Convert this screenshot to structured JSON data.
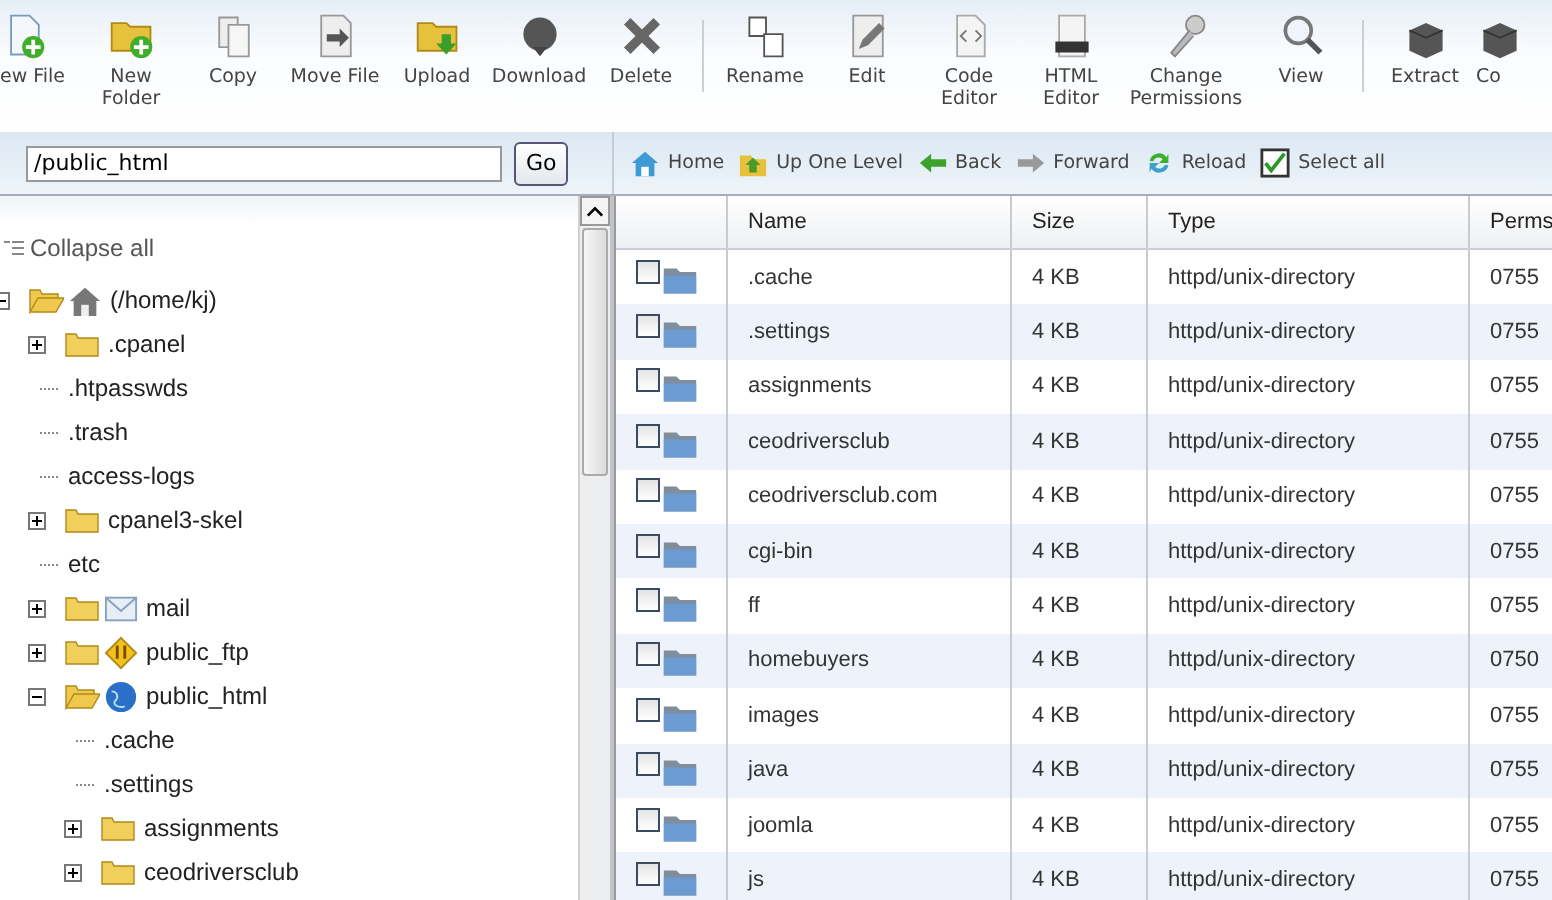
{
  "toolbar": [
    {
      "items": [
        {
          "kind": "new-file",
          "label": "ew File"
        },
        {
          "kind": "new-folder",
          "label": "New Folder"
        },
        {
          "kind": "copy",
          "label": "Copy"
        },
        {
          "kind": "move",
          "label": "Move File"
        },
        {
          "kind": "upload",
          "label": "Upload"
        },
        {
          "kind": "download",
          "label": "Download"
        },
        {
          "kind": "delete",
          "label": "Delete"
        }
      ]
    },
    {
      "items": [
        {
          "kind": "rename",
          "label": "Rename"
        },
        {
          "kind": "edit",
          "label": "Edit"
        },
        {
          "kind": "code",
          "label": "Code Editor"
        },
        {
          "kind": "html",
          "label": "HTML Editor"
        },
        {
          "kind": "permissions",
          "label": "Change Permissions"
        },
        {
          "kind": "view",
          "label": "View"
        }
      ]
    },
    {
      "items": [
        {
          "kind": "extract",
          "label": "Extract"
        },
        {
          "kind": "compress",
          "label": "Co"
        }
      ]
    }
  ],
  "path_field": {
    "value": "/public_html",
    "button": "Go"
  },
  "nav": [
    {
      "kind": "home",
      "label": "Home"
    },
    {
      "kind": "up",
      "label": "Up One Level"
    },
    {
      "kind": "back",
      "label": "Back"
    },
    {
      "kind": "forward",
      "label": "Forward"
    },
    {
      "kind": "reload",
      "label": "Reload"
    },
    {
      "kind": "select-all",
      "label": "Select all"
    }
  ],
  "tree": {
    "collapse_label": "Collapse all",
    "items": [
      {
        "kind": "home",
        "label": "(/home/kj)",
        "expanded": true,
        "children": [
          {
            "kind": "folder",
            "label": ".cpanel",
            "expanded": false
          },
          {
            "kind": "file",
            "label": ".htpasswds"
          },
          {
            "kind": "file",
            "label": ".trash"
          },
          {
            "kind": "file",
            "label": "access-logs"
          },
          {
            "kind": "folder",
            "label": "cpanel3-skel",
            "expanded": false
          },
          {
            "kind": "file",
            "label": "etc"
          },
          {
            "kind": "mail",
            "label": "mail",
            "expanded": false
          },
          {
            "kind": "ftp",
            "label": "public_ftp",
            "expanded": false
          },
          {
            "kind": "web",
            "label": "public_html",
            "expanded": true,
            "children": [
              {
                "kind": "file",
                "label": ".cache"
              },
              {
                "kind": "file",
                "label": ".settings"
              },
              {
                "kind": "folder",
                "label": "assignments",
                "expanded": false
              },
              {
                "kind": "folder",
                "label": "ceodriversclub",
                "expanded": false
              }
            ]
          }
        ]
      }
    ]
  },
  "table": {
    "columns": [
      "Name",
      "Size",
      "Type",
      "Perms"
    ],
    "rows": [
      {
        "checked": false,
        "name": ".cache",
        "size": "4 KB",
        "type": "httpd/unix-directory",
        "perms": "0755"
      },
      {
        "checked": false,
        "name": ".settings",
        "size": "4 KB",
        "type": "httpd/unix-directory",
        "perms": "0755"
      },
      {
        "checked": false,
        "name": "assignments",
        "size": "4 KB",
        "type": "httpd/unix-directory",
        "perms": "0755"
      },
      {
        "checked": false,
        "name": "ceodriversclub",
        "size": "4 KB",
        "type": "httpd/unix-directory",
        "perms": "0755"
      },
      {
        "checked": false,
        "name": "ceodriversclub.com",
        "size": "4 KB",
        "type": "httpd/unix-directory",
        "perms": "0755"
      },
      {
        "checked": false,
        "name": "cgi-bin",
        "size": "4 KB",
        "type": "httpd/unix-directory",
        "perms": "0755"
      },
      {
        "checked": false,
        "name": "ff",
        "size": "4 KB",
        "type": "httpd/unix-directory",
        "perms": "0755"
      },
      {
        "checked": false,
        "name": "homebuyers",
        "size": "4 KB",
        "type": "httpd/unix-directory",
        "perms": "0750"
      },
      {
        "checked": false,
        "name": "images",
        "size": "4 KB",
        "type": "httpd/unix-directory",
        "perms": "0755"
      },
      {
        "checked": false,
        "name": "java",
        "size": "4 KB",
        "type": "httpd/unix-directory",
        "perms": "0755"
      },
      {
        "checked": false,
        "name": "joomla",
        "size": "4 KB",
        "type": "httpd/unix-directory",
        "perms": "0755"
      },
      {
        "checked": false,
        "name": "js",
        "size": "4 KB",
        "type": "httpd/unix-directory",
        "perms": "0755"
      }
    ]
  }
}
